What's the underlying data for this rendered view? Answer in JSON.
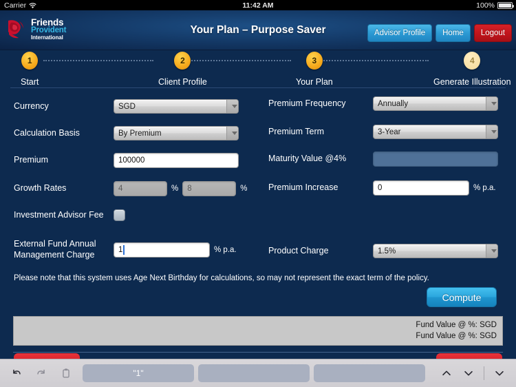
{
  "statusbar": {
    "carrier": "Carrier",
    "wifi_icon": "wifi-icon",
    "time": "11:42 AM",
    "battery_pct": "100%",
    "battery_icon": "battery-full-icon"
  },
  "header": {
    "logo": {
      "icon": "rose-logo-icon",
      "line1": "Friends",
      "line2": "Provident",
      "line3": "International"
    },
    "title": "Your Plan – Purpose Saver",
    "buttons": [
      {
        "label": "Advisor Profile",
        "name": "advisor-profile-button",
        "style": "blue"
      },
      {
        "label": "Home",
        "name": "home-button",
        "style": "blue"
      },
      {
        "label": "Logout",
        "name": "logout-button",
        "style": "red"
      }
    ]
  },
  "steps": [
    {
      "number": "1",
      "label": "Start",
      "active": true
    },
    {
      "number": "2",
      "label": "Client Profile",
      "active": true
    },
    {
      "number": "3",
      "label": "Your Plan",
      "active": true
    },
    {
      "number": "4",
      "label": "Generate Illustration",
      "active": false
    }
  ],
  "form": {
    "currency": {
      "label": "Currency",
      "value": "SGD"
    },
    "calculation_basis": {
      "label": "Calculation Basis",
      "value": "By Premium"
    },
    "premium": {
      "label": "Premium",
      "value": "100000"
    },
    "growth_rates": {
      "label": "Growth Rates",
      "value1": "4",
      "value2": "8",
      "unit1": "%",
      "unit2": "%"
    },
    "investment_advisor_fee": {
      "label": "Investment Advisor Fee",
      "checked": false
    },
    "external_fund_charge": {
      "label_line1": "External Fund Annual",
      "label_line2": "Management Charge",
      "value": "1",
      "unit": "% p.a."
    },
    "premium_frequency": {
      "label": "Premium Frequency",
      "value": "Annually"
    },
    "premium_term": {
      "label": "Premium Term",
      "value": "3-Year"
    },
    "maturity_value": {
      "label": "Maturity Value @4%",
      "value": ""
    },
    "premium_increase": {
      "label": "Premium Increase",
      "value": "0",
      "unit": "% p.a."
    },
    "product_charge": {
      "label": "Product Charge",
      "value": "1.5%"
    }
  },
  "note": "Please note that this system uses Age Next Birthday for calculations, so may not represent the exact term of the policy.",
  "compute_button": "Compute",
  "results": [
    "Fund Value @ %: SGD",
    "Fund Value @ %: SGD"
  ],
  "keyboard_bar": {
    "undo_icon": "undo-icon",
    "redo_icon": "redo-icon",
    "paste_icon": "paste-icon",
    "suggestions": [
      "\"1\"",
      "",
      ""
    ],
    "prev_icon": "chevron-up-icon",
    "next_icon": "chevron-down-icon",
    "dismiss_icon": "chevron-down-dismiss-icon"
  },
  "colors": {
    "background": "#0d2a4f",
    "accent_blue": "#2ba6dd",
    "logo_cyan": "#35b7e4",
    "danger_red": "#c9151d",
    "step_gold": "#f5a91c"
  }
}
